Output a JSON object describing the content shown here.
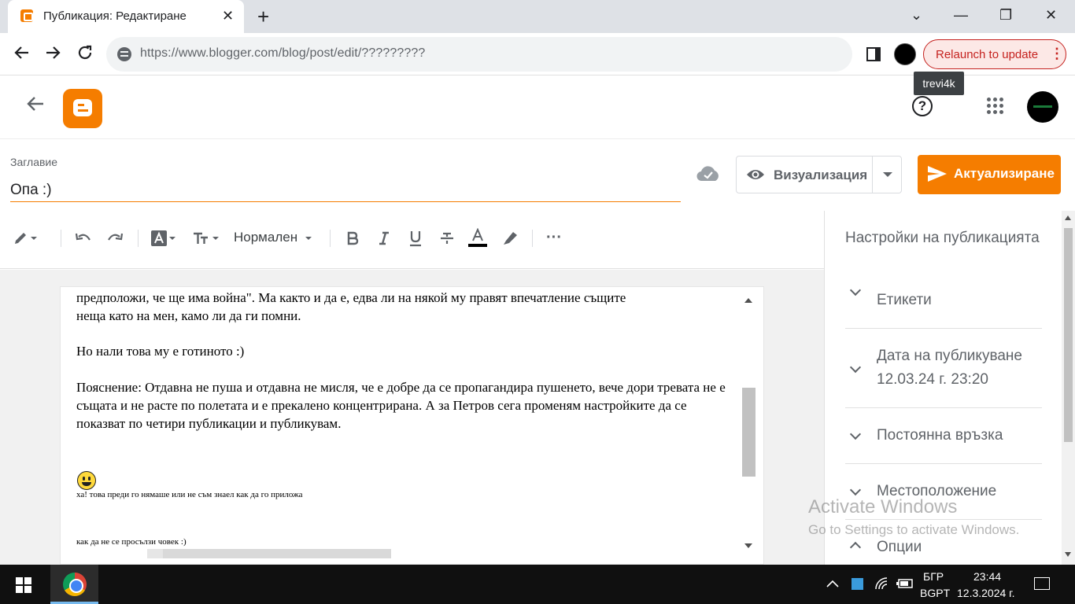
{
  "browser": {
    "tab_title": "Публикация: Редактиране",
    "tab_close": "✕",
    "new_tab": "+",
    "url": "https://www.blogger.com/blog/post/edit/?????????",
    "relaunch_label": "Relaunch to update",
    "profile_tooltip": "trevi4k",
    "window_controls": [
      "⌄",
      "—",
      "❐",
      "✕"
    ]
  },
  "header": {
    "help": "?"
  },
  "post": {
    "title_label": "Заглавие",
    "title_value": "Опа :)",
    "preview_label": "Визуализация",
    "update_label": "Актуализиране"
  },
  "toolbar": {
    "paragraph_style": "Нормален",
    "more": "···"
  },
  "document": {
    "line_cut": "предположи, че ще има война\". Ма както и да е, едва ли на някой му правят впечатление същите",
    "line_2": "неща като на мен, камо ли да ги помни.",
    "para_2": "Но нали това му е готиното :)",
    "para_3": "Пояснение: Отдавна не пуша и отдавна не мисля, че е добре да се пропагандира пушенето, вече дори тревата не е същата и не расте по полетата и е прекалено концентрирана. А за Петров сега променям настройките да се показват по четири публикации и публикувам.",
    "small_1": "ха! това преди го нямаше или не съм знаел как да го приложа",
    "small_2": "как да не се просълзи човек :)"
  },
  "settings": {
    "title": "Настройки на публикацията",
    "items": [
      {
        "label": "Етикети"
      },
      {
        "label": "Дата на публикуване",
        "sub": "12.03.24 г. 23:20"
      },
      {
        "label": "Постоянна връзка"
      },
      {
        "label": "Местоположение"
      },
      {
        "label": "Опции"
      }
    ]
  },
  "watermark": {
    "line1": "Activate Windows",
    "line2": "Go to Settings to activate Windows."
  },
  "taskbar": {
    "lang_1": "БГР",
    "lang_2": "BGPT",
    "time": "23:44",
    "date": "12.3.2024 г."
  },
  "colors": {
    "accent": "#f57d00",
    "relaunch": "#c5221f",
    "taskbar": "#101010"
  }
}
